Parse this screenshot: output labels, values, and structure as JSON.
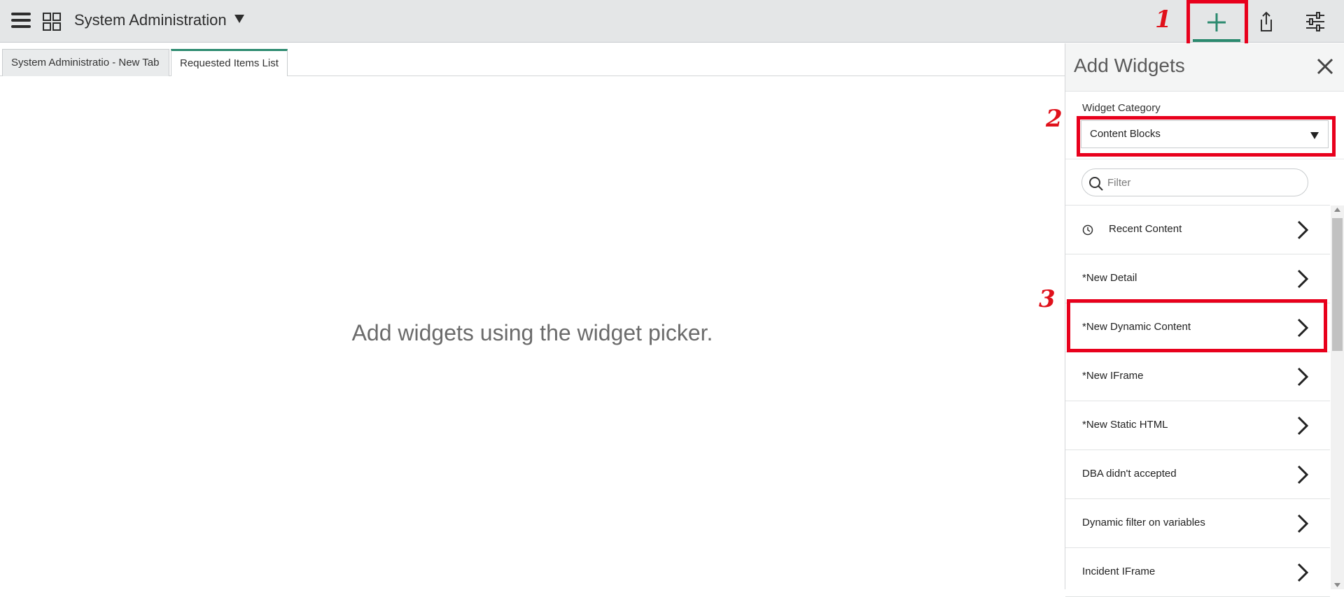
{
  "header": {
    "app_title": "System Administration"
  },
  "annotations": [
    "1",
    "2",
    "3"
  ],
  "tabs": [
    {
      "label": "System Administratio - New Tab",
      "active": false
    },
    {
      "label": "Requested Items List",
      "active": true
    }
  ],
  "main": {
    "empty_message": "Add widgets using the widget picker."
  },
  "panel": {
    "title": "Add Widgets",
    "category_label": "Widget Category",
    "category_value": "Content Blocks",
    "filter_placeholder": "Filter",
    "items": [
      {
        "label": "Recent Content",
        "icon": "clock-icon"
      },
      {
        "label": "*New Detail"
      },
      {
        "label": "*New Dynamic Content"
      },
      {
        "label": "*New IFrame"
      },
      {
        "label": "*New Static HTML"
      },
      {
        "label": "DBA didn't accepted"
      },
      {
        "label": "Dynamic filter on variables"
      },
      {
        "label": "Incident IFrame"
      }
    ]
  },
  "colors": {
    "accent": "#2b8a6f",
    "highlight": "#e8001c",
    "topbar": "#e4e6e7"
  }
}
